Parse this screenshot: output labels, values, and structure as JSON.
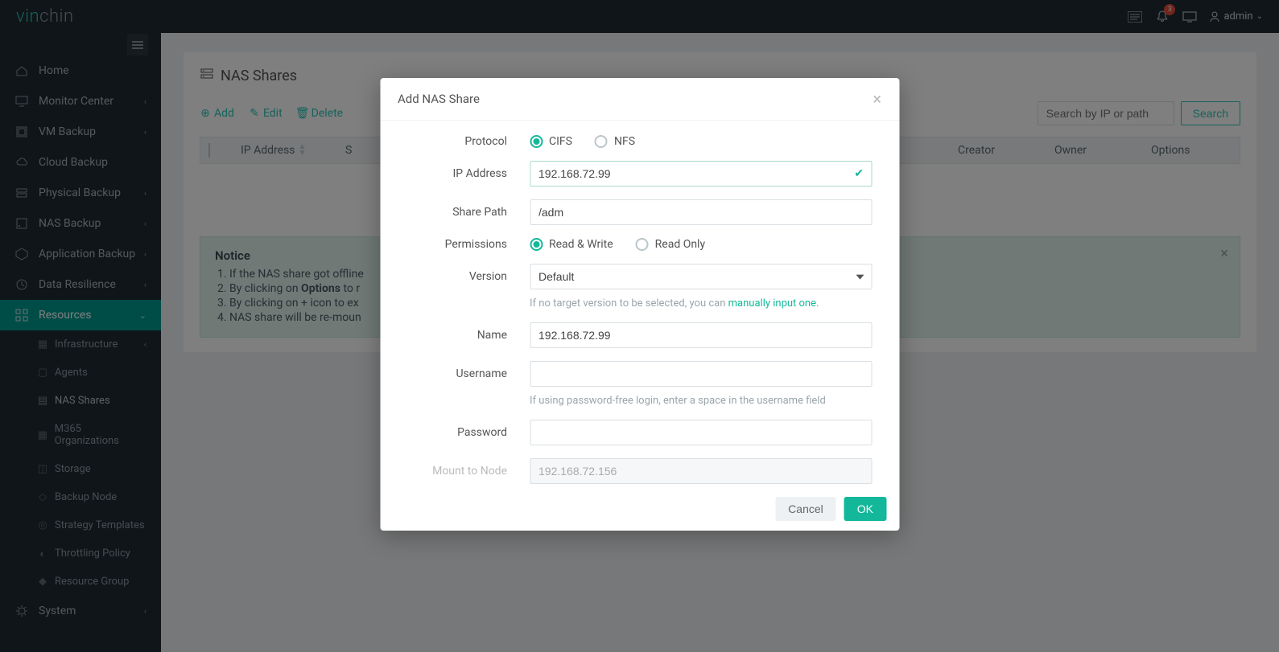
{
  "brand": {
    "part1": "vin",
    "part2": "chin"
  },
  "topbar": {
    "notif_count": "3",
    "user": "admin"
  },
  "sidebar": {
    "items": [
      {
        "label": "Home",
        "icon": "home"
      },
      {
        "label": "Monitor Center",
        "icon": "monitor",
        "expandable": true
      },
      {
        "label": "VM Backup",
        "icon": "vm",
        "expandable": true
      },
      {
        "label": "Cloud Backup",
        "icon": "cloud"
      },
      {
        "label": "Physical Backup",
        "icon": "physical",
        "expandable": true
      },
      {
        "label": "NAS Backup",
        "icon": "nas",
        "expandable": true
      },
      {
        "label": "Application Backup",
        "icon": "app",
        "expandable": true
      },
      {
        "label": "Data Resilience",
        "icon": "resilience",
        "expandable": true
      },
      {
        "label": "Resources",
        "icon": "resources",
        "expandable": true,
        "active": true
      }
    ],
    "resources_sub": [
      {
        "label": "Infrastructure",
        "expandable": true
      },
      {
        "label": "Agents"
      },
      {
        "label": "NAS Shares",
        "active": true
      },
      {
        "label": "M365 Organizations"
      },
      {
        "label": "Storage"
      },
      {
        "label": "Backup Node"
      },
      {
        "label": "Strategy Templates"
      },
      {
        "label": "Throttling Policy"
      },
      {
        "label": "Resource Group"
      }
    ],
    "system_label": "System"
  },
  "page": {
    "title": "NAS Shares",
    "toolbar": {
      "add": "Add",
      "edit": "Edit",
      "delete": "Delete"
    },
    "search_placeholder": "Search by IP or path",
    "search_btn": "Search",
    "columns": {
      "ip": "IP Address",
      "s": "S",
      "creator": "Creator",
      "owner": "Owner",
      "options": "Options"
    },
    "notice_title": "Notice",
    "notice_1": "If the NAS share got offline",
    "notice_2_prefix": "By clicking on ",
    "notice_2_bold": "Options",
    "notice_2_suffix": " to r",
    "notice_3": "By clicking on + icon to ex",
    "notice_4": "NAS share will be re-moun"
  },
  "modal": {
    "title": "Add NAS Share",
    "labels": {
      "protocol": "Protocol",
      "ip": "IP Address",
      "share_path": "Share Path",
      "permissions": "Permissions",
      "version": "Version",
      "name": "Name",
      "username": "Username",
      "password": "Password",
      "mount": "Mount to Node"
    },
    "protocol": {
      "cifs": "CIFS",
      "nfs": "NFS"
    },
    "ip_value": "192.168.72.99",
    "share_path_value": "/adm",
    "permissions": {
      "rw": "Read & Write",
      "ro": "Read Only"
    },
    "version_value": "Default",
    "version_hint_1": "If no target version to be selected, you can ",
    "version_hint_link": "manually input one.",
    "name_value": "192.168.72.99",
    "username_hint": "If using password-free login, enter a space in the username field",
    "mount_value": "192.168.72.156",
    "cancel": "Cancel",
    "ok": "OK"
  }
}
